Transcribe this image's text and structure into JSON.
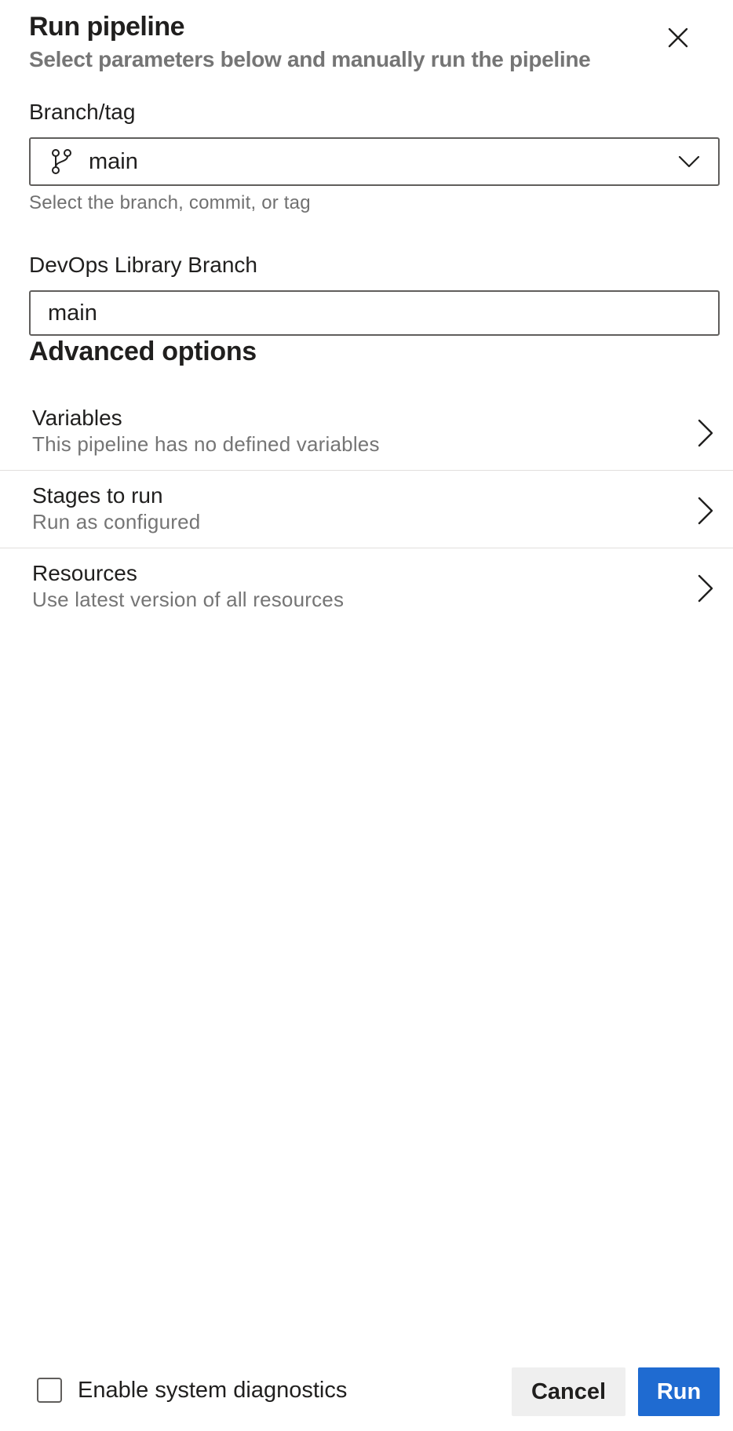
{
  "dialog": {
    "title": "Run pipeline",
    "subtitle": "Select parameters below and manually run the pipeline"
  },
  "branch_field": {
    "label": "Branch/tag",
    "value": "main",
    "helper": "Select the branch, commit, or tag"
  },
  "library_field": {
    "label": "DevOps Library Branch",
    "value": "main"
  },
  "advanced": {
    "title": "Advanced options",
    "items": [
      {
        "title": "Variables",
        "subtitle": "This pipeline has no defined variables"
      },
      {
        "title": "Stages to run",
        "subtitle": "Run as configured"
      },
      {
        "title": "Resources",
        "subtitle": "Use latest version of all resources"
      }
    ]
  },
  "footer": {
    "diagnostics_label": "Enable system diagnostics",
    "diagnostics_checked": false,
    "cancel_label": "Cancel",
    "run_label": "Run"
  },
  "colors": {
    "primary": "#1f6bd1",
    "secondary_text": "#757575",
    "border": "#605e5c"
  },
  "icons": {
    "close": "close-icon",
    "branch": "git-branch-icon",
    "dropdown": "chevron-down-icon",
    "row_chevron": "chevron-right-icon"
  }
}
